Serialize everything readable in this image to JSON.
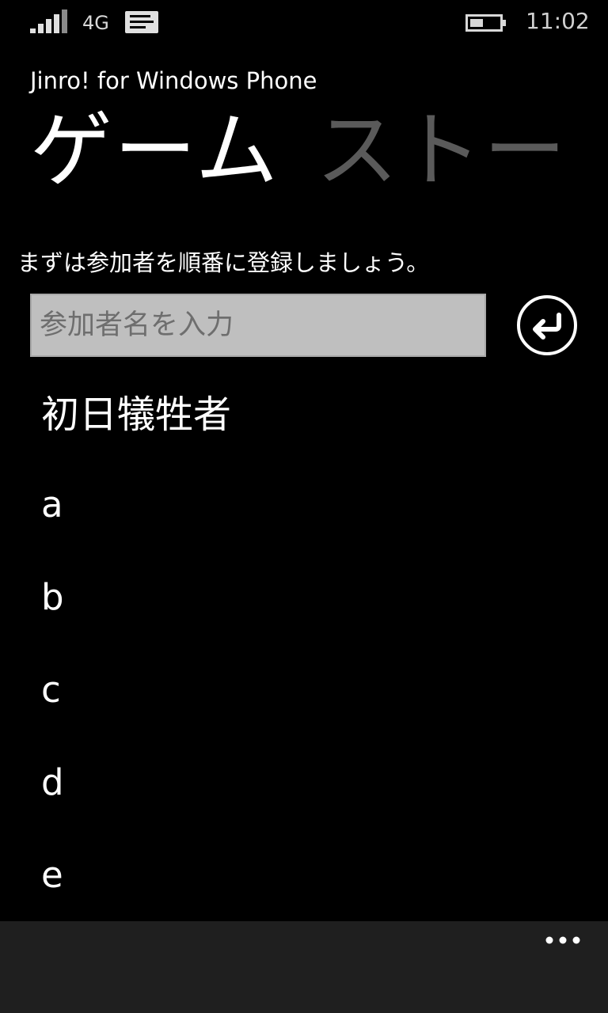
{
  "status_bar": {
    "network": "4G",
    "time": "11:02",
    "icons": [
      "signal-icon",
      "message-icon",
      "battery-icon"
    ]
  },
  "header": {
    "app_title": "Jinro! for Windows Phone",
    "pivot": [
      {
        "label": "ゲーム",
        "active": true
      },
      {
        "label": "ストー",
        "active": false
      }
    ]
  },
  "main": {
    "instruction": "まずは参加者を順番に登録しましょう。",
    "input": {
      "value": "",
      "placeholder": "参加者名を入力"
    },
    "enter_button_icon": "enter-icon",
    "players": [
      "初日犠牲者",
      "a",
      "b",
      "c",
      "d",
      "e"
    ]
  },
  "app_bar": {
    "more_icon": "more-icon"
  },
  "colors": {
    "background": "#000000",
    "input_background": "#bfbfbf",
    "inactive_pivot": "#5a5a5a",
    "app_bar": "#1f1f1f"
  }
}
